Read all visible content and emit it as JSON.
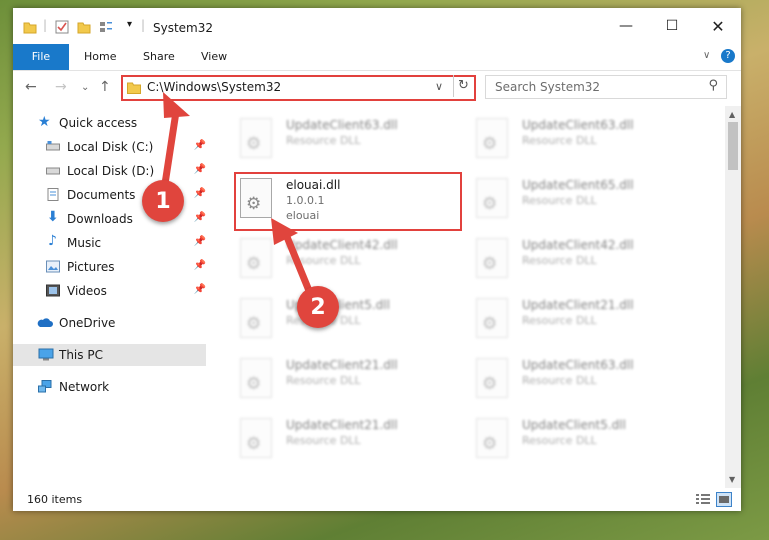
{
  "window": {
    "title": "System32"
  },
  "ribbon": {
    "tabs": [
      "File",
      "Home",
      "Share",
      "View"
    ]
  },
  "address": {
    "path": "C:\\Windows\\System32"
  },
  "search": {
    "placeholder": "Search System32"
  },
  "nav": {
    "items": [
      {
        "label": "Quick access",
        "icon": "star-icon"
      },
      {
        "label": "Local Disk (C:)",
        "icon": "drive-icon"
      },
      {
        "label": "Local Disk (D:)",
        "icon": "drive-icon"
      },
      {
        "label": "Documents",
        "icon": "documents-icon"
      },
      {
        "label": "Downloads",
        "icon": "download-icon"
      },
      {
        "label": "Music",
        "icon": "music-icon"
      },
      {
        "label": "Pictures",
        "icon": "pictures-icon"
      },
      {
        "label": "Videos",
        "icon": "videos-icon"
      },
      {
        "label": "OneDrive",
        "icon": "cloud-icon"
      },
      {
        "label": "This PC",
        "icon": "computer-icon"
      },
      {
        "label": "Network",
        "icon": "network-icon"
      }
    ]
  },
  "files": [
    {
      "name": "UpdateClient63.dll",
      "type": "Resource DLL"
    },
    {
      "name": "UpdateClient63.dll",
      "type": "Resource DLL"
    },
    {
      "name": "elouai.dll",
      "version": "1.0.0.1",
      "desc": "elouai"
    },
    {
      "name": "UpdateClient65.dll",
      "type": "Resource DLL"
    },
    {
      "name": "UpdateClient42.dll",
      "type": "Resource DLL"
    },
    {
      "name": "UpdateClient42.dll",
      "type": "Resource DLL"
    },
    {
      "name": "UpdateClient5.dll",
      "type": "Resource DLL"
    },
    {
      "name": "UpdateClient21.dll",
      "type": "Resource DLL"
    },
    {
      "name": "UpdateClient21.dll",
      "type": "Resource DLL"
    },
    {
      "name": "UpdateClient63.dll",
      "type": "Resource DLL"
    },
    {
      "name": "UpdateClient21.dll",
      "type": "Resource DLL"
    },
    {
      "name": "UpdateClient5.dll",
      "type": "Resource DLL"
    }
  ],
  "status": {
    "count": "160 items"
  },
  "callouts": {
    "one": "1",
    "two": "2"
  },
  "colors": {
    "accent": "#1979ca",
    "highlight": "#e2413d"
  }
}
